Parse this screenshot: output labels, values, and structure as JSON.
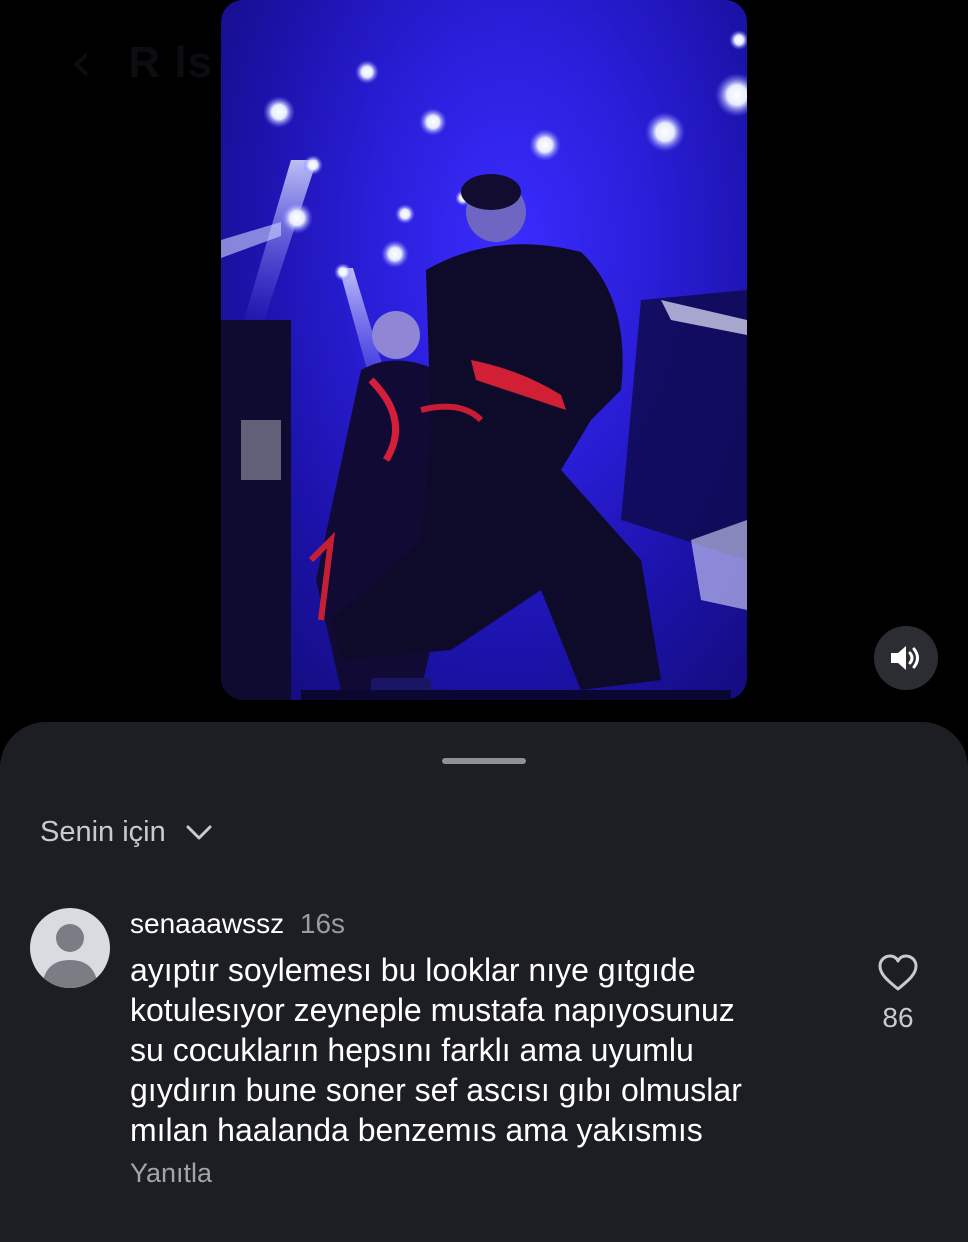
{
  "header": {
    "title": "R  ls  R"
  },
  "video": {
    "sound_icon": "speaker-wave-icon"
  },
  "comments": {
    "filter_label": "Senin için",
    "items": [
      {
        "username": "senaaawssz",
        "time": "16s",
        "text": "ayıptır soylemesı bu looklar nıye gıtgıde\nkotulesıyor zeyneple mustafa napıyosunuz\nsu cocukların hepsını farklı ama uyumlu\ngıydırın bune soner sef ascısı gıbı olmuslar\nmılan haalanda benzemıs ama yakısmıs",
        "reply_label": "Yanıtla",
        "like_count": "86"
      }
    ]
  }
}
